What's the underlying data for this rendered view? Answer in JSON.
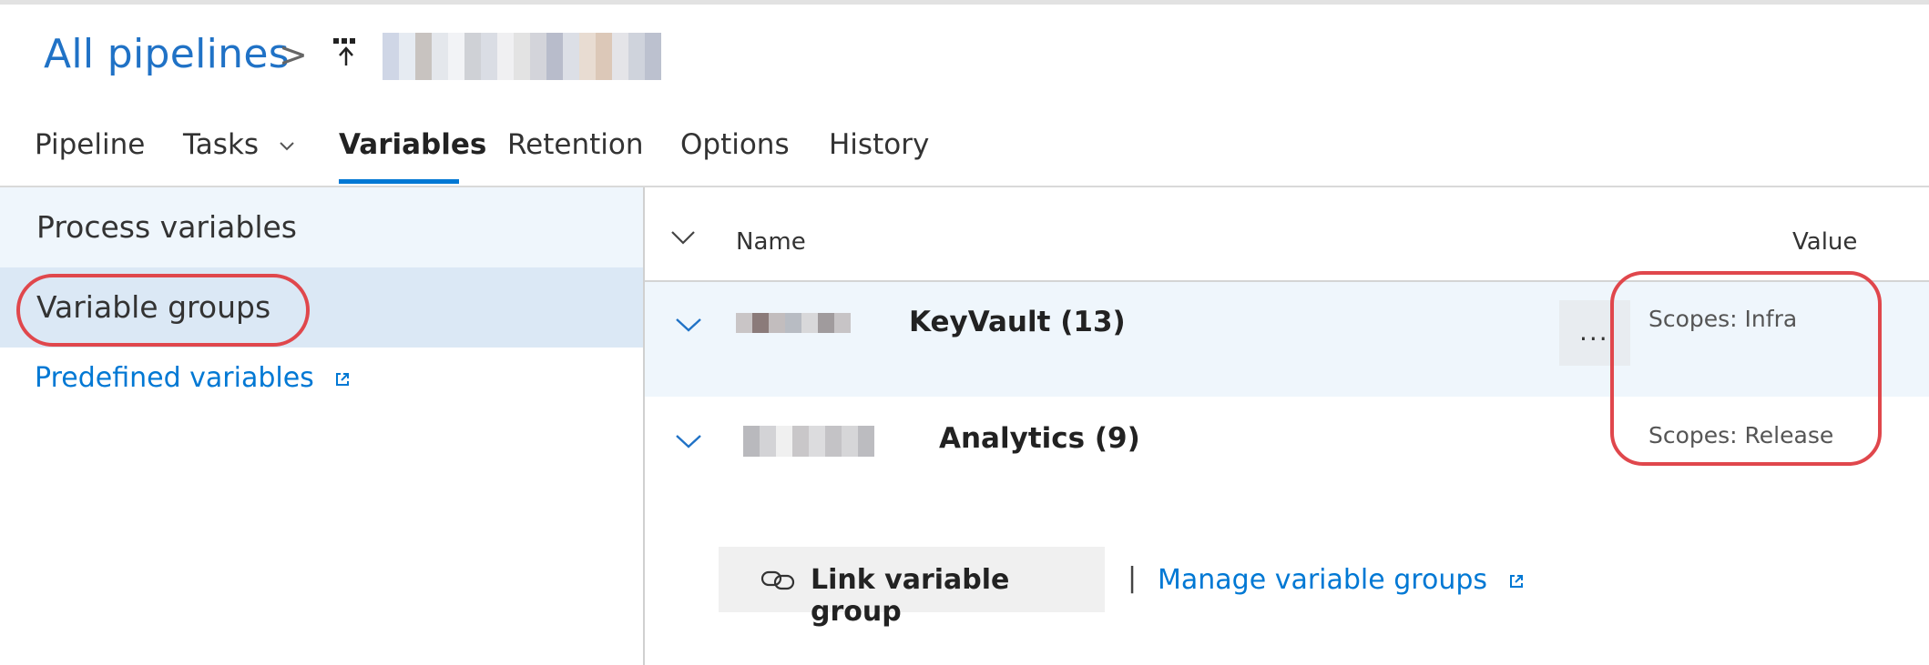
{
  "breadcrumb": {
    "root_label": "All pipelines",
    "separator": ">",
    "pipeline_icon": "build-pipeline-icon"
  },
  "tabs": [
    {
      "label": "Pipeline",
      "active": false
    },
    {
      "label": "Tasks",
      "active": false,
      "has_dropdown": true
    },
    {
      "label": "Variables",
      "active": true
    },
    {
      "label": "Retention",
      "active": false
    },
    {
      "label": "Options",
      "active": false
    },
    {
      "label": "History",
      "active": false
    }
  ],
  "sidebar": {
    "items": [
      {
        "label": "Process variables",
        "selected": false
      },
      {
        "label": "Variable groups",
        "selected": true
      }
    ],
    "predefined_link": "Predefined variables",
    "predefined_icon": "external-link-icon"
  },
  "table": {
    "col_name": "Name",
    "col_value": "Value",
    "groups": [
      {
        "name_suffix": "KeyVault (13)",
        "scope": "Scopes: Infra",
        "more": "..."
      },
      {
        "name_suffix": "Analytics (9)",
        "scope": "Scopes: Release"
      }
    ]
  },
  "actions": {
    "link_button": "Link variable group",
    "link_icon": "link-icon",
    "separator": "|",
    "manage_link": "Manage variable groups",
    "manage_icon": "external-link-icon"
  },
  "colors": {
    "accent": "#0078d4",
    "breadcrumb_link": "#2072c6",
    "selected_bg": "#dbe8f5",
    "highlight_circle": "#e0474c"
  }
}
